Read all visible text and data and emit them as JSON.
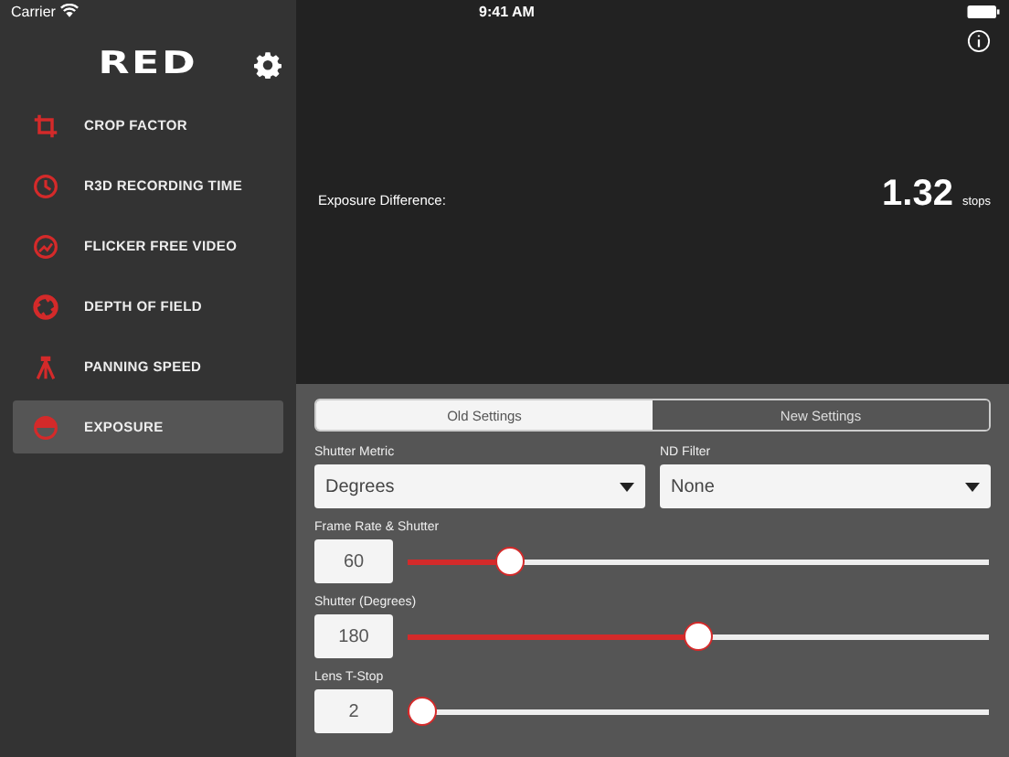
{
  "status_bar": {
    "carrier": "Carrier",
    "time": "9:41 AM"
  },
  "sidebar": {
    "logo": "RED",
    "items": [
      {
        "label": "CROP FACTOR",
        "selected": false
      },
      {
        "label": "R3D RECORDING TIME",
        "selected": false
      },
      {
        "label": "FLICKER FREE VIDEO",
        "selected": false
      },
      {
        "label": "DEPTH OF FIELD",
        "selected": false
      },
      {
        "label": "PANNING SPEED",
        "selected": false
      },
      {
        "label": "EXPOSURE",
        "selected": true
      }
    ]
  },
  "result": {
    "label": "Exposure Difference:",
    "value": "1.32",
    "unit": "stops"
  },
  "tabs": [
    {
      "label": "Old Settings",
      "selected": true
    },
    {
      "label": "New Settings",
      "selected": false
    }
  ],
  "dropdowns": [
    {
      "label": "Shutter Metric",
      "value": "Degrees"
    },
    {
      "label": "ND Filter",
      "value": "None"
    }
  ],
  "sliders": [
    {
      "label": "Frame Rate & Shutter",
      "value": "60",
      "level": 0.16
    },
    {
      "label": "Shutter (Degrees)",
      "value": "180",
      "level": 0.5
    },
    {
      "label": "Lens T-Stop",
      "value": "2",
      "level": 0
    }
  ]
}
